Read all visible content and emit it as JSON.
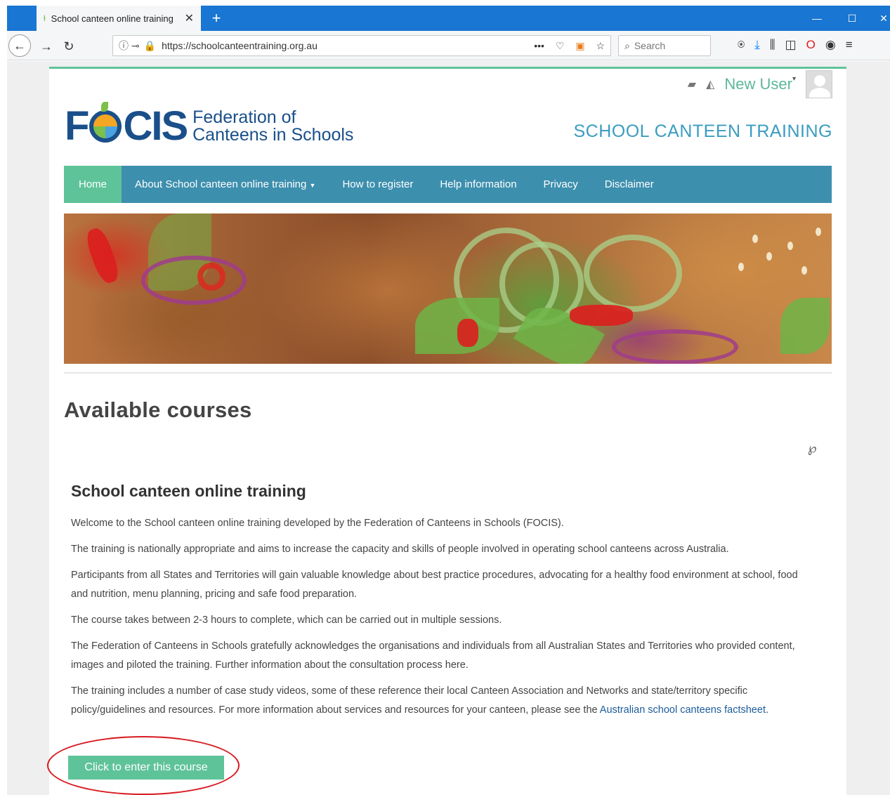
{
  "browser": {
    "tab_title": "School canteen online training",
    "new_tab_icon": "+",
    "url": "https://schoolcanteentraining.org.au",
    "search_placeholder": "Search"
  },
  "header": {
    "user_name": "New User",
    "site_title": "SCHOOL CANTEEN TRAINING",
    "logo": {
      "letters_before": "F",
      "letters_after": "CIS",
      "line1": "Federation of",
      "line2": "Canteens in Schools"
    }
  },
  "nav": {
    "items": [
      {
        "label": "Home",
        "active": true
      },
      {
        "label": "About School canteen online training",
        "dropdown": true
      },
      {
        "label": "How to register"
      },
      {
        "label": "Help information"
      },
      {
        "label": "Privacy"
      },
      {
        "label": "Disclaimer"
      }
    ]
  },
  "main": {
    "heading": "Available courses",
    "course": {
      "title": "School canteen online training",
      "paragraphs": [
        "Welcome to the School canteen online training developed by the Federation of Canteens in Schools (FOCIS).",
        "The training is nationally appropriate and aims to increase the capacity and skills of people involved in operating school canteens across Australia.",
        "Participants from all States and Territories will gain valuable knowledge about best practice procedures, advocating for a healthy food environment at school, food and nutrition, menu planning, pricing and safe food preparation.",
        "The course takes between 2-3 hours to complete, which can be carried out in multiple sessions.",
        "The Federation of Canteens in Schools gratefully acknowledges the organisations and individuals from all Australian States and Territories who provided content, images and piloted the training. Further information about the consultation process here."
      ],
      "last_paragraph_text": "The training includes a number of case study videos, some of these reference their local Canteen Association and Networks and state/territory specific policy/guidelines and resources. For more information about services and resources for your canteen, please see the ",
      "factsheet_link": "Australian school canteens factsheet",
      "last_paragraph_end": ".",
      "enter_button": "Click to enter this course"
    }
  },
  "colors": {
    "accent_green": "#5fc39a",
    "nav_blue": "#3d8fae",
    "logo_blue": "#1a4f8a",
    "browser_blue": "#1976d2",
    "highlight_red": "#d71920"
  }
}
